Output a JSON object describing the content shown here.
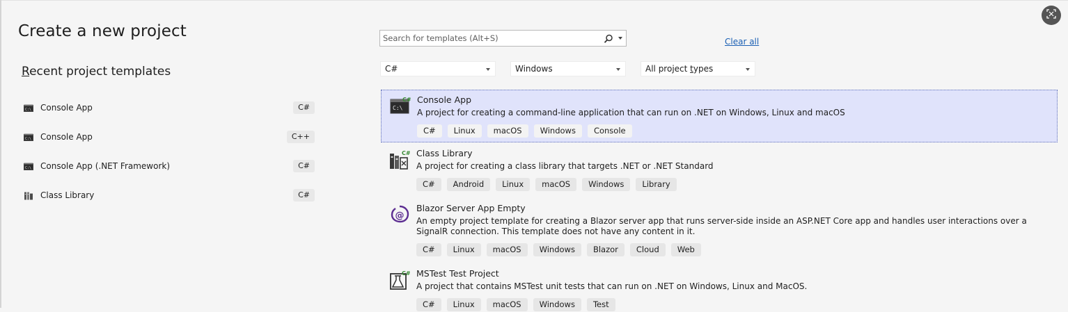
{
  "header": {
    "title": "Create a new project"
  },
  "recent": {
    "title_first": "R",
    "title_rest": "ecent project templates",
    "items": [
      {
        "label": "Console App",
        "lang": "C#",
        "icon": "console-app-icon"
      },
      {
        "label": "Console App",
        "lang": "C++",
        "icon": "console-app-icon"
      },
      {
        "label": "Console App (.NET Framework)",
        "lang": "C#",
        "icon": "console-app-icon"
      },
      {
        "label": "Class Library",
        "lang": "C#",
        "icon": "class-library-icon"
      }
    ]
  },
  "search": {
    "placeholder": "Search for templates (Alt+S)",
    "value": ""
  },
  "clear_all": "Clear all",
  "filters": {
    "language": "C#",
    "platform": "Windows",
    "project_type_first": "All project ",
    "project_type_u": "t",
    "project_type_rest": "ypes"
  },
  "templates": [
    {
      "name": "Console App",
      "description": "A project for creating a command-line application that can run on .NET on Windows, Linux and macOS",
      "tags": [
        "C#",
        "Linux",
        "macOS",
        "Windows",
        "Console"
      ],
      "icon": "console-app-icon",
      "selected": true
    },
    {
      "name": "Class Library",
      "description": "A project for creating a class library that targets .NET or .NET Standard",
      "tags": [
        "C#",
        "Android",
        "Linux",
        "macOS",
        "Windows",
        "Library"
      ],
      "icon": "class-library-icon"
    },
    {
      "name": "Blazor Server App Empty",
      "description": "An empty project template for creating a Blazor server app that runs server-side inside an ASP.NET Core app and handles user interactions over a SignalR connection. This template does not have any content in it.",
      "tags": [
        "C#",
        "Linux",
        "macOS",
        "Windows",
        "Blazor",
        "Cloud",
        "Web"
      ],
      "icon": "blazor-icon"
    },
    {
      "name": "MSTest Test Project",
      "description": "A project that contains MSTest unit tests that can run on .NET on Windows, Linux and MacOS.",
      "tags": [
        "C#",
        "Linux",
        "macOS",
        "Windows",
        "Test"
      ],
      "icon": "test-project-icon"
    }
  ],
  "colors": {
    "accent": "#1a5fb4",
    "selected_bg": "#e0e3fb",
    "csharp_green": "#388a34",
    "blazor_purple": "#5c2d91"
  }
}
